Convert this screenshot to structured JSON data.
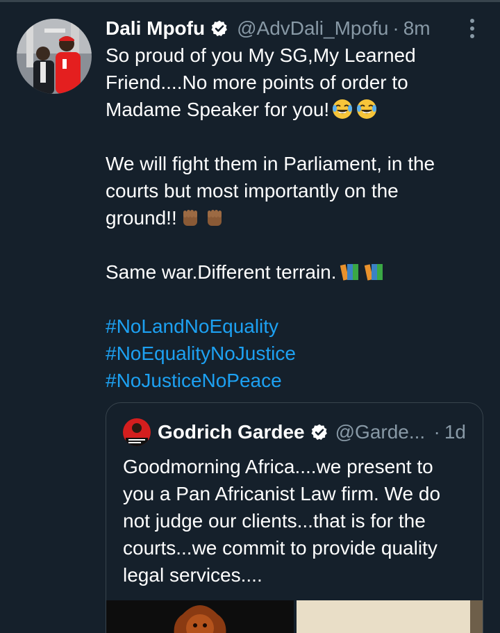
{
  "tweet": {
    "author_name": "Dali Mpofu",
    "handle": "@AdvDali_Mpofu",
    "separator": "·",
    "time": "8m",
    "lines": {
      "l1": "So proud of you My SG,My Learned",
      "l2": "Friend....No more points of order to",
      "l3": "Madame Speaker for you!",
      "l4": "We will fight them in Parliament, in the",
      "l5": "courts but most importantly on the",
      "l6": "ground!!",
      "l7": "Same war.Different terrain."
    },
    "hashtags": [
      "#NoLandNoEquality",
      "#NoEqualityNoJustice",
      "#NoJusticeNoPeace"
    ],
    "emojis": [
      "face-with-tears-of-joy-icon",
      "raised-fist-icon",
      "books-icon"
    ]
  },
  "quoted_tweet": {
    "author_name": "Godrich Gardee",
    "handle": "@Garde...",
    "separator": "·",
    "time": "1d",
    "lines": [
      "Goodmorning Africa....we present to",
      "you a Pan Africanist Law firm. We do",
      "not judge our clients...that is for the",
      "courts...we commit to provide quality",
      "legal services...."
    ]
  },
  "colors": {
    "background": "#15202b",
    "text": "#ffffff",
    "secondary_text": "#8899a6",
    "accent": "#1da1f2",
    "border": "#38444d"
  }
}
